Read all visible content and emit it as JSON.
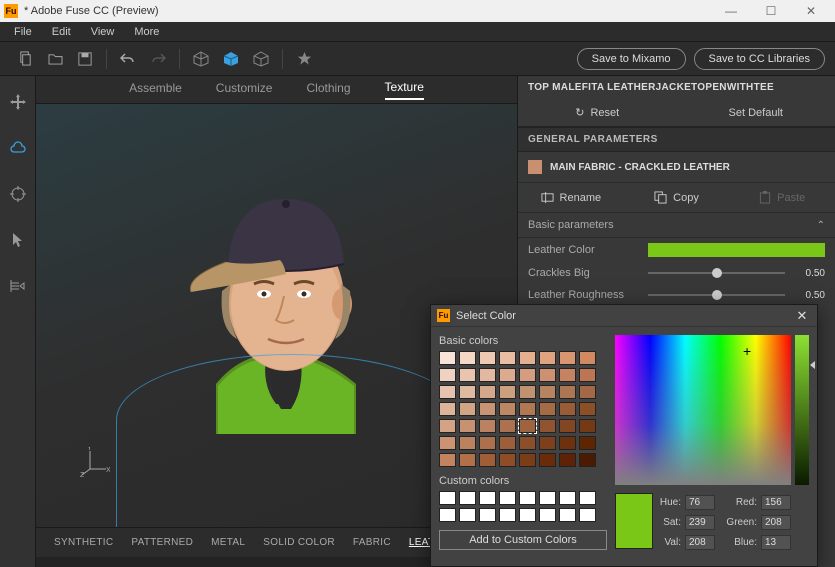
{
  "titlebar": {
    "text": "* Adobe Fuse CC (Preview)"
  },
  "menu": {
    "file": "File",
    "edit": "Edit",
    "view": "View",
    "more": "More"
  },
  "toolbar": {
    "save_mixamo": "Save to Mixamo",
    "save_cc": "Save to CC Libraries"
  },
  "tabs": {
    "assemble": "Assemble",
    "customize": "Customize",
    "clothing": "Clothing",
    "texture": "Texture"
  },
  "bottom_tabs": [
    "SYNTHETIC",
    "PATTERNED",
    "METAL",
    "SOLID COLOR",
    "FABRIC",
    "LEATHER"
  ],
  "right": {
    "title": "TOP MALEFITA LEATHERJACKETOPENWITHTEE",
    "reset": "Reset",
    "set_default": "Set Default",
    "general": "GENERAL PARAMETERS",
    "fabric": "MAIN FABRIC - CRACKLED LEATHER",
    "rename": "Rename",
    "copy": "Copy",
    "paste": "Paste",
    "basic": "Basic parameters",
    "params": {
      "leather_color": {
        "label": "Leather Color",
        "value": "#7ac718"
      },
      "crackles_big": {
        "label": "Crackles Big",
        "value": "0.50"
      },
      "leather_roughness": {
        "label": "Leather Roughness",
        "value": "0.50"
      }
    }
  },
  "dialog": {
    "title": "Select Color",
    "basic_label": "Basic colors",
    "custom_label": "Custom colors",
    "add_btn": "Add to Custom Colors",
    "hue": {
      "label": "Hue:",
      "value": "76"
    },
    "sat": {
      "label": "Sat:",
      "value": "239"
    },
    "val": {
      "label": "Val:",
      "value": "208"
    },
    "red": {
      "label": "Red:",
      "value": "156"
    },
    "green": {
      "label": "Green:",
      "value": "208"
    },
    "blue": {
      "label": "Blue:",
      "value": "13"
    },
    "swatches": [
      "#f7e3d7",
      "#f5d7c5",
      "#eecab3",
      "#e9bda1",
      "#e4b090",
      "#dfa380",
      "#d79670",
      "#d18961",
      "#efd3c2",
      "#e9c5b0",
      "#e3b8a0",
      "#dcaa8f",
      "#d59d7f",
      "#cd9070",
      "#c58361",
      "#bd7653",
      "#e6c3ae",
      "#debaa0",
      "#d3a88c",
      "#caa07f",
      "#c09270",
      "#b78461",
      "#ad7653",
      "#a36846",
      "#ddb39a",
      "#d2a486",
      "#c79574",
      "#bc8763",
      "#b07953",
      "#a46b44",
      "#985d36",
      "#8c5029",
      "#d4a386",
      "#c79272",
      "#ba8260",
      "#ac724f",
      "#9e633f",
      "#905430",
      "#824622",
      "#743915",
      "#cb9372",
      "#bc815e",
      "#ad704c",
      "#9d5f3a",
      "#8d4f2a",
      "#7d401b",
      "#6d320d",
      "#5d2500",
      "#c2835e",
      "#b1704a",
      "#a05e37",
      "#8e4d26",
      "#7c3c16",
      "#6a2c08",
      "#5e2206",
      "#4a1a01"
    ]
  }
}
